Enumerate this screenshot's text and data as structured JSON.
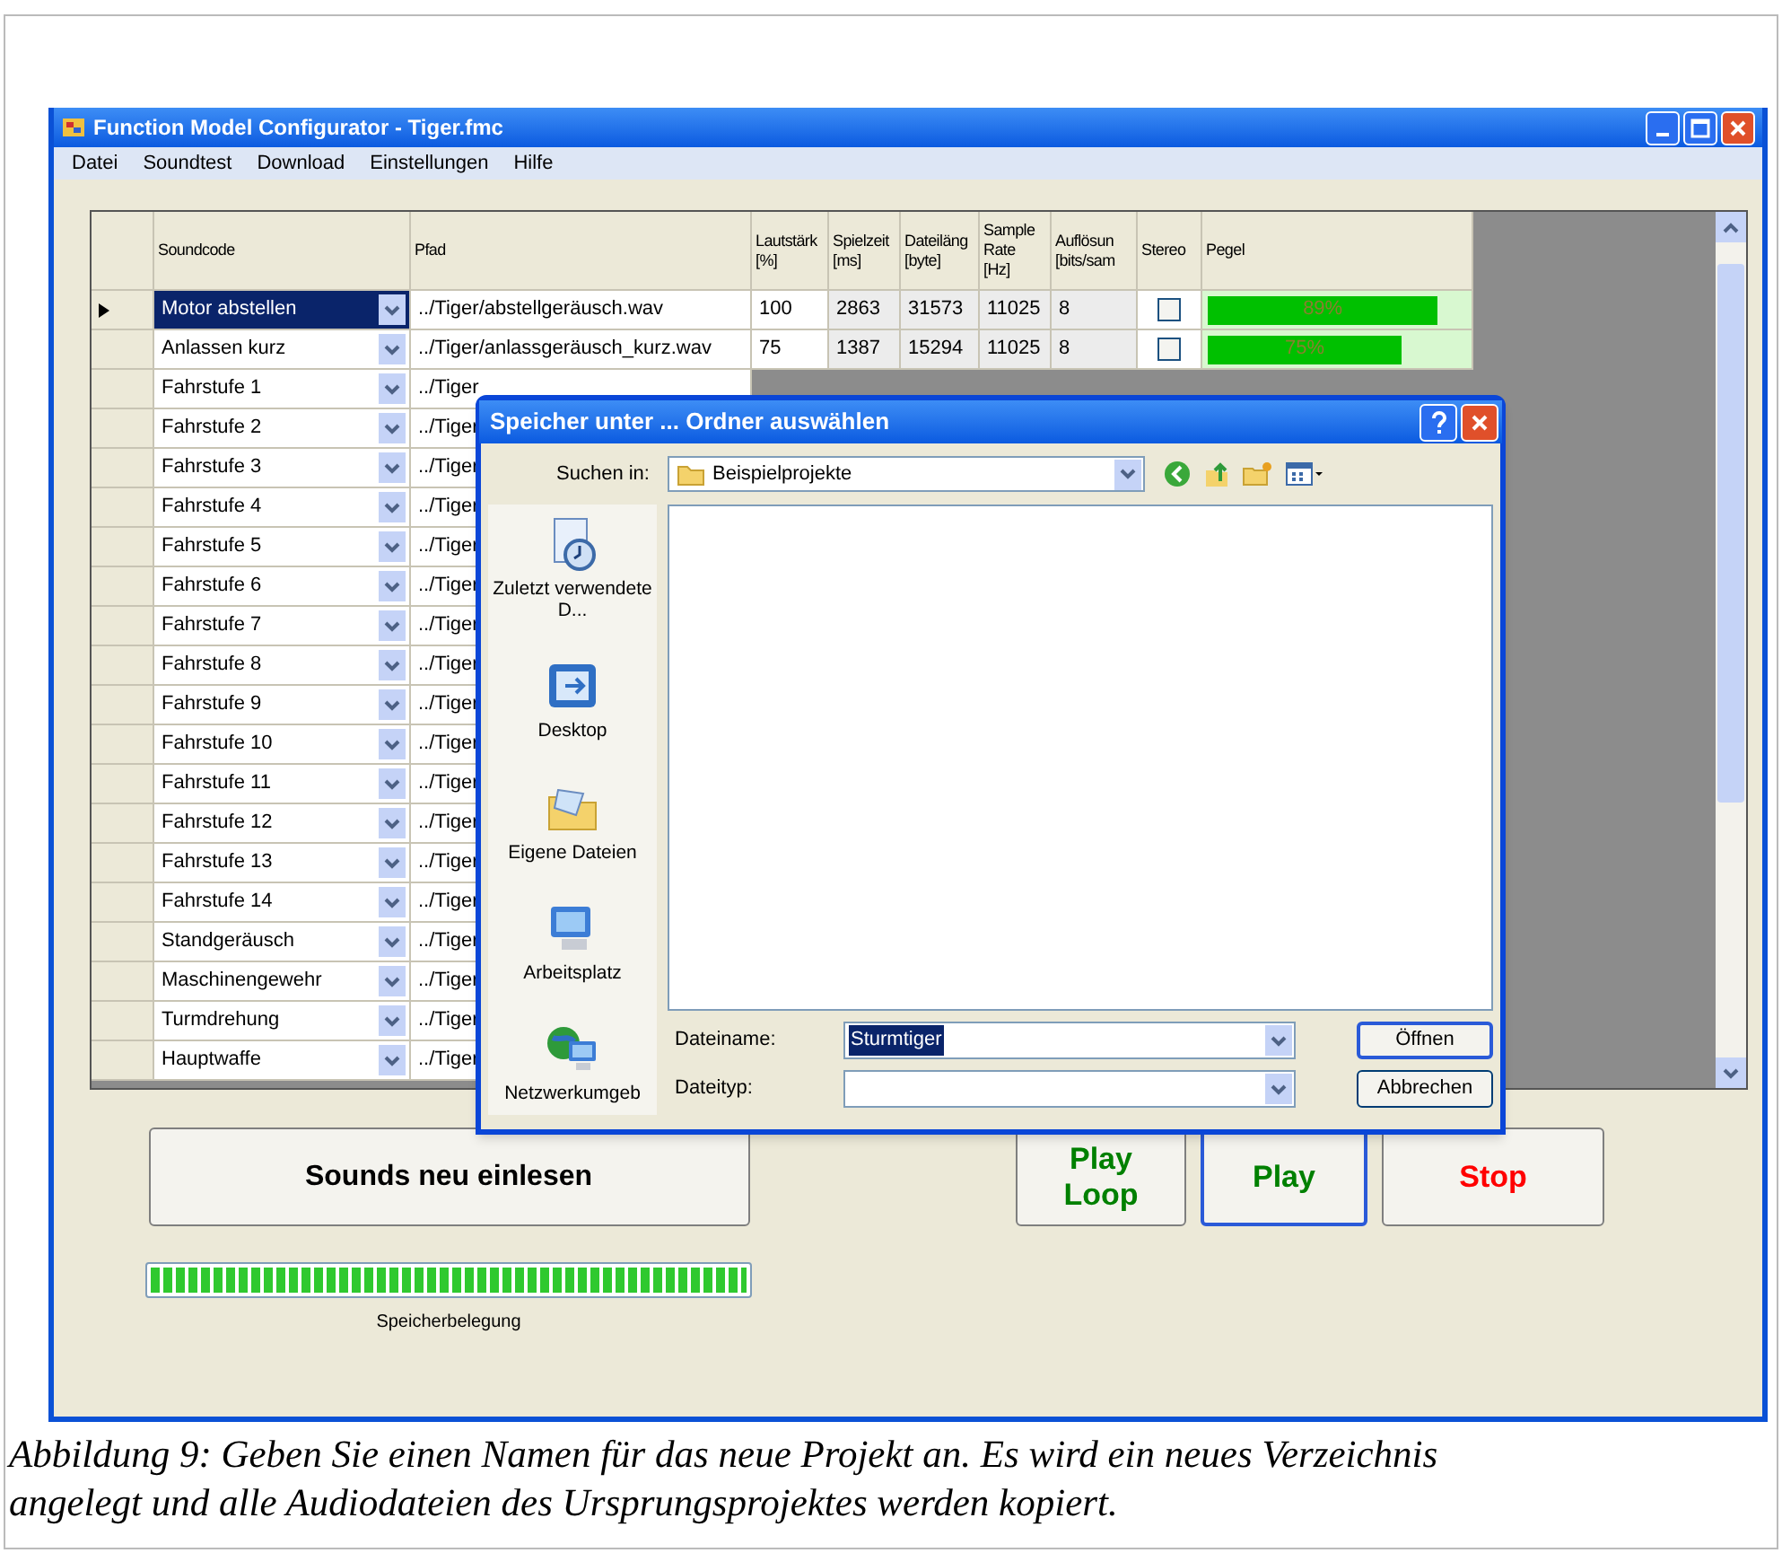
{
  "window": {
    "title": "Function Model Configurator - Tiger.fmc"
  },
  "menu": [
    "Datei",
    "Soundtest",
    "Download",
    "Einstellungen",
    "Hilfe"
  ],
  "table": {
    "columns": [
      [
        "Soundcode"
      ],
      [
        "Pfad"
      ],
      [
        "Lautstärk",
        "[%]"
      ],
      [
        "Spielzeit",
        "[ms]"
      ],
      [
        "Dateiläng",
        "[byte]"
      ],
      [
        "Sample",
        "Rate",
        "[Hz]"
      ],
      [
        "Auflösun",
        "[bits/sam"
      ],
      [
        "Stereo"
      ],
      [
        "Pegel"
      ]
    ],
    "rows": [
      {
        "current": true,
        "selected": true,
        "soundcode": "Motor abstellen",
        "path": "../Tiger/abstellgeräusch.wav",
        "volume": "100",
        "duration": "2863",
        "file_length": "31573",
        "sample_rate": "11025",
        "resolution": "8",
        "stereo": false,
        "level": 0.89,
        "level_text": "89%"
      },
      {
        "current": false,
        "selected": false,
        "soundcode": "Anlassen kurz",
        "path": "../Tiger/anlassgeräusch_kurz.wav",
        "volume": "75",
        "duration": "1387",
        "file_length": "15294",
        "sample_rate": "11025",
        "resolution": "8",
        "stereo": false,
        "level": 0.75,
        "level_text": "75%"
      },
      {
        "current": false,
        "selected": false,
        "soundcode": "Fahrstufe 1",
        "path": "../Tiger"
      },
      {
        "current": false,
        "selected": false,
        "soundcode": "Fahrstufe 2",
        "path": "../Tiger"
      },
      {
        "current": false,
        "selected": false,
        "soundcode": "Fahrstufe 3",
        "path": "../Tiger"
      },
      {
        "current": false,
        "selected": false,
        "soundcode": "Fahrstufe 4",
        "path": "../Tiger"
      },
      {
        "current": false,
        "selected": false,
        "soundcode": "Fahrstufe 5",
        "path": "../Tiger"
      },
      {
        "current": false,
        "selected": false,
        "soundcode": "Fahrstufe 6",
        "path": "../Tiger"
      },
      {
        "current": false,
        "selected": false,
        "soundcode": "Fahrstufe 7",
        "path": "../Tiger"
      },
      {
        "current": false,
        "selected": false,
        "soundcode": "Fahrstufe 8",
        "path": "../Tiger"
      },
      {
        "current": false,
        "selected": false,
        "soundcode": "Fahrstufe 9",
        "path": "../Tiger"
      },
      {
        "current": false,
        "selected": false,
        "soundcode": "Fahrstufe 10",
        "path": "../Tiger"
      },
      {
        "current": false,
        "selected": false,
        "soundcode": "Fahrstufe 11",
        "path": "../Tiger"
      },
      {
        "current": false,
        "selected": false,
        "soundcode": "Fahrstufe 12",
        "path": "../Tiger"
      },
      {
        "current": false,
        "selected": false,
        "soundcode": "Fahrstufe 13",
        "path": "../Tiger"
      },
      {
        "current": false,
        "selected": false,
        "soundcode": "Fahrstufe 14",
        "path": "../Tiger"
      },
      {
        "current": false,
        "selected": false,
        "soundcode": "Standgeräusch",
        "path": "../Tiger"
      },
      {
        "current": false,
        "selected": false,
        "soundcode": "Maschinengewehr",
        "path": "../Tiger"
      },
      {
        "current": false,
        "selected": false,
        "soundcode": "Turmdrehung",
        "path": "../Tiger"
      },
      {
        "current": false,
        "selected": false,
        "soundcode": "Hauptwaffe",
        "path": "../Tiger"
      }
    ]
  },
  "dialog": {
    "title": "Speicher unter ... Ordner auswählen",
    "look_in_label": "Suchen in:",
    "look_in_value": "Beispielprojekte",
    "places": [
      {
        "kind": "recent",
        "label": "Zuletzt verwendete D..."
      },
      {
        "kind": "desktop",
        "label": "Desktop"
      },
      {
        "kind": "documents",
        "label": "Eigene Dateien"
      },
      {
        "kind": "computer",
        "label": "Arbeitsplatz"
      },
      {
        "kind": "network",
        "label": "Netzwerkumgeb"
      }
    ],
    "filename_label": "Dateiname:",
    "filename_value": "Sturmtiger",
    "filetype_label": "Dateityp:",
    "open_button": "Öffnen",
    "cancel_button": "Abbrechen"
  },
  "buttons": [
    {
      "label": "Sounds neu einlesen",
      "color": "#000000",
      "focused": false
    },
    {
      "label": "Play Loop",
      "color": "#008000",
      "focused": false
    },
    {
      "label": "Play",
      "color": "#008000",
      "focused": true
    },
    {
      "label": "Stop",
      "color": "#ff0000",
      "focused": false
    }
  ],
  "memory": {
    "level": 1,
    "label": "Speicherbelegung"
  },
  "caption": "Abbildung 9: Geben Sie einen Namen für das neue Projekt an. Es wird ein neues Verzeichnis angelegt und alle Audiodateien des Ursprungsprojektes werden kopiert."
}
